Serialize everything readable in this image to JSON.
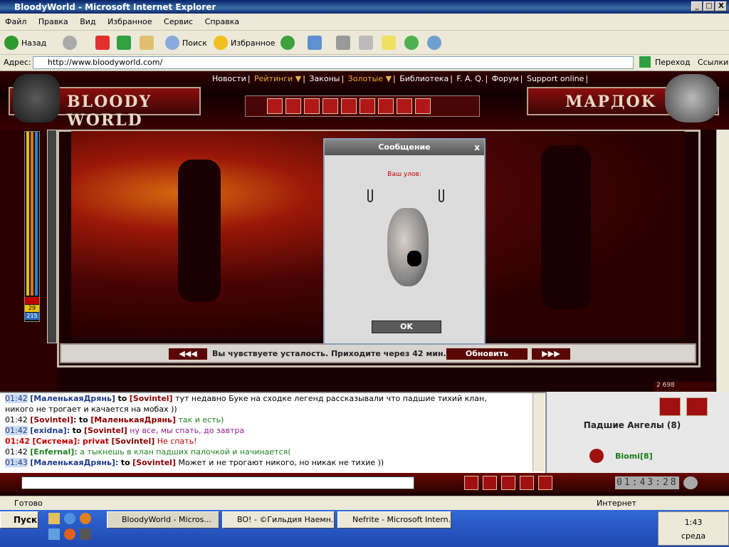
{
  "window": {
    "title": "BloodyWorld - Microsoft Internet Explorer",
    "min": "_",
    "max": "□",
    "close": "X"
  },
  "menu": [
    "Файл",
    "Правка",
    "Вид",
    "Избранное",
    "Сервис",
    "Справка"
  ],
  "toolbar": {
    "back": "Назад",
    "search": "Поиск",
    "favorites": "Избранное"
  },
  "address": {
    "label": "Адрес:",
    "url": "http://www.bloodyworld.com/",
    "go": "Переход",
    "links": "Ссылки"
  },
  "site": {
    "nav": [
      "Новости",
      "Рейтинги ▼",
      "Законы",
      "Золотые ▼",
      "Библиотека",
      "F. A. Q.",
      "Форум",
      "Support online"
    ],
    "logo": "BLOODY WORLD",
    "username": "MAPДOK",
    "gauge": [
      "29",
      "215"
    ],
    "counter": "2 698",
    "status": "Вы чувствуете усталость. Приходите через 42 мин.",
    "refresh": "Обновить",
    "prev": "◀◀◀",
    "next": "▶▶▶"
  },
  "dialog": {
    "title": "Сообщение",
    "close": "x",
    "catch": "Ваш улов:",
    "ok": "OK"
  },
  "chat": {
    "lines": [
      {
        "time": "01:42",
        "time_style": "sel",
        "nick": "[МаленькаяДрянь]",
        "to": "to",
        "tgt": "[Sovintel]",
        "msg": "тут недавно Буке на сходке легенд рассказывали что падшие тихий клан,",
        "nick_color": "#1f3a8a",
        "msg_color": "#000"
      },
      {
        "time": "",
        "nick": "",
        "to": "",
        "tgt": "",
        "msg": "никого не трогает и качается на мобах ))",
        "nick_color": "#000",
        "msg_color": "#000"
      },
      {
        "time": "01:42",
        "nick": "[Sovintel]:",
        "to": "to",
        "tgt": "[МаленькаяДрянь]",
        "msg": "так и есть)",
        "nick_color": "#8a0000",
        "msg_color": "#208020"
      },
      {
        "time": "",
        "nick": "",
        "to": "",
        "tgt": "",
        "msg": "",
        "nick_color": "#000",
        "msg_color": "#000"
      },
      {
        "time": "01:42",
        "time_style": "sel",
        "nick": "[exidna]:",
        "to": "to",
        "tgt": "[Sovintel]",
        "msg": "ну все, мы спать, до завтра",
        "nick_color": "#1f3a8a",
        "msg_color": "#8a208a"
      },
      {
        "time": "01:42",
        "time_style": "red",
        "nick": "[Система]:",
        "to": "privat",
        "tgt": "[Sovintel]",
        "msg": "Не спать!",
        "nick_color": "#c00000",
        "msg_color": "#c00000"
      },
      {
        "time": "01:42",
        "nick": "[Enfernal]:",
        "to": "",
        "tgt": "",
        "msg": "а тыкнешь в клан падших палочкой и начинается(",
        "nick_color": "#208020",
        "msg_color": "#208020"
      },
      {
        "time": "01:43",
        "time_style": "sel",
        "nick": "[МаленькаяДрянь]:",
        "to": "to",
        "tgt": "[Sovintel]",
        "msg": "Может и не трогают никого, но никак не тихие ))",
        "nick_color": "#1f3a8a",
        "msg_color": "#000"
      }
    ]
  },
  "panel": {
    "clan": "Падшие Ангелы (8)",
    "member": "Biomi[8]"
  },
  "clock": "01:43:28",
  "statusbar": {
    "ready": "Готово",
    "zone": "Интернет"
  },
  "taskbar": {
    "start": "Пуск",
    "tasks": [
      "BloodyWorld - Micros...",
      "BO! - ©Гильдия Наемн...",
      "Nefrite - Microsoft Intern..."
    ],
    "time": "1:43",
    "day": "среда"
  }
}
